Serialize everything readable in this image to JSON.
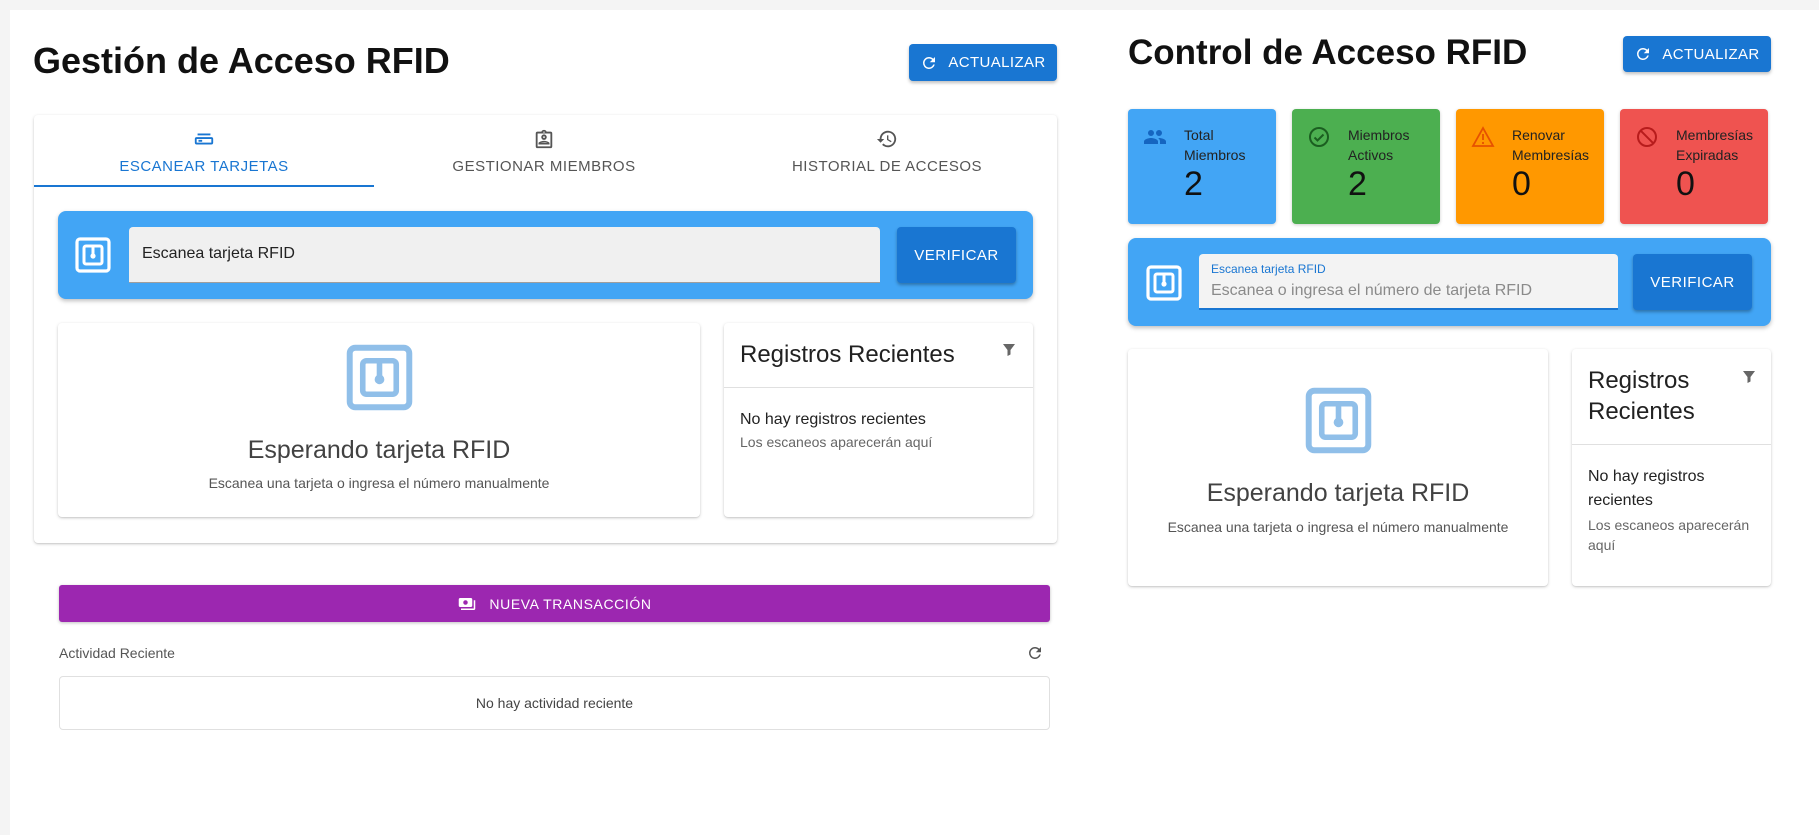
{
  "left": {
    "title": "Gestión de Acceso RFID",
    "refresh_label": "ACTUALIZAR",
    "tabs": [
      {
        "label": "ESCANEAR TARJETAS",
        "icon": "card-reader-icon",
        "active": true
      },
      {
        "label": "GESTIONAR MIEMBROS",
        "icon": "badge-icon",
        "active": false
      },
      {
        "label": "HISTORIAL DE ACCESOS",
        "icon": "history-icon",
        "active": false
      }
    ],
    "scan": {
      "value": "Escanea tarjeta RFID",
      "verify_label": "VERIFICAR"
    },
    "waiting": {
      "title": "Esperando tarjeta RFID",
      "subtitle": "Escanea una tarjeta o ingresa el número manualmente"
    },
    "recent": {
      "title": "Registros Recientes",
      "empty_title": "No hay registros recientes",
      "empty_sub": "Los escaneos aparecerán aquí"
    },
    "transaction_label": "NUEVA TRANSACCIÓN",
    "activity": {
      "label": "Actividad Reciente",
      "empty": "No hay actividad reciente"
    }
  },
  "right": {
    "title": "Control de Acceso RFID",
    "refresh_label": "ACTUALIZAR",
    "stats": [
      {
        "label_line1": "Total",
        "label_line2": "Miembros",
        "value": "2",
        "color": "#42a5f5",
        "icon": "people-icon"
      },
      {
        "label_line1": "Miembros",
        "label_line2": "Activos",
        "value": "2",
        "color": "#4caf50",
        "icon": "check-circle-icon"
      },
      {
        "label_line1": "Renovar",
        "label_line2": "Membresías",
        "value": "0",
        "color": "#ff9800",
        "icon": "warning-icon"
      },
      {
        "label_line1": "Membresías",
        "label_line2": "Expiradas",
        "value": "0",
        "color": "#ef5350",
        "icon": "blocked-icon"
      }
    ],
    "scan": {
      "label": "Escanea tarjeta RFID",
      "placeholder": "Escanea o ingresa el número de tarjeta RFID",
      "verify_label": "VERIFICAR"
    },
    "waiting": {
      "title": "Esperando tarjeta RFID",
      "subtitle": "Escanea una tarjeta o ingresa el número manualmente"
    },
    "recent": {
      "title_line1": "Registros",
      "title_line2": "Recientes",
      "empty_title_line1": "No hay registros",
      "empty_title_line2": "recientes",
      "empty_sub_line1": "Los escaneos aparecerán",
      "empty_sub_line2": "aquí"
    }
  },
  "colors": {
    "primary": "#1976d2",
    "scan_bar": "#42a5f5",
    "transaction": "#9c27b0",
    "rfid_icon": "#90bfe9"
  }
}
